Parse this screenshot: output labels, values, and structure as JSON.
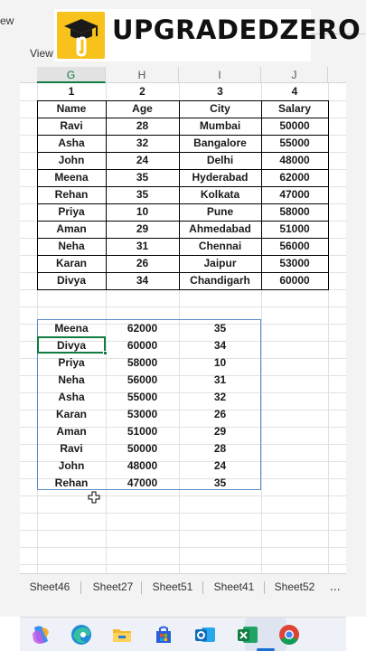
{
  "ribbon": {
    "fragment_text": "ew",
    "view_label": "View"
  },
  "brand": {
    "name": "UPGRADEDZERO",
    "badge_color": "#f7c21c",
    "icons": [
      "graduation-cap-icon",
      "paperclip-icon"
    ]
  },
  "spreadsheet": {
    "columns": [
      "G",
      "H",
      "I",
      "J"
    ],
    "active_column": "G",
    "number_row": [
      "1",
      "2",
      "3",
      "4"
    ],
    "table": {
      "headers": [
        "Name",
        "Age",
        "City",
        "Salary"
      ],
      "rows": [
        [
          "Ravi",
          "28",
          "Mumbai",
          "50000"
        ],
        [
          "Asha",
          "32",
          "Bangalore",
          "55000"
        ],
        [
          "John",
          "24",
          "Delhi",
          "48000"
        ],
        [
          "Meena",
          "35",
          "Hyderabad",
          "62000"
        ],
        [
          "Rehan",
          "35",
          "Kolkata",
          "47000"
        ],
        [
          "Priya",
          "10",
          "Pune",
          "58000"
        ],
        [
          "Aman",
          "29",
          "Ahmedabad",
          "51000"
        ],
        [
          "Neha",
          "31",
          "Chennai",
          "56000"
        ],
        [
          "Karan",
          "26",
          "Jaipur",
          "53000"
        ],
        [
          "Divya",
          "34",
          "Chandigarh",
          "60000"
        ]
      ]
    },
    "sorted": {
      "rows": [
        [
          "Meena",
          "62000",
          "35"
        ],
        [
          "Divya",
          "60000",
          "34"
        ],
        [
          "Priya",
          "58000",
          "10"
        ],
        [
          "Neha",
          "56000",
          "31"
        ],
        [
          "Asha",
          "55000",
          "32"
        ],
        [
          "Karan",
          "53000",
          "26"
        ],
        [
          "Aman",
          "51000",
          "29"
        ],
        [
          "Ravi",
          "50000",
          "28"
        ],
        [
          "John",
          "48000",
          "24"
        ],
        [
          "Rehan",
          "47000",
          "35"
        ]
      ],
      "active_cell_value": "Divya"
    },
    "selection_color": "#5b8bc7",
    "active_cell_color": "#107c41"
  },
  "sheet_tabs": {
    "tabs": [
      "Sheet46",
      "Sheet27",
      "Sheet51",
      "Sheet41",
      "Sheet52"
    ],
    "more_label": "..."
  },
  "taskbar": {
    "apps": [
      "copilot-icon",
      "edge-icon",
      "file-explorer-icon",
      "microsoft-store-icon",
      "outlook-icon",
      "excel-icon",
      "chrome-icon"
    ],
    "active_app": "excel-icon"
  }
}
